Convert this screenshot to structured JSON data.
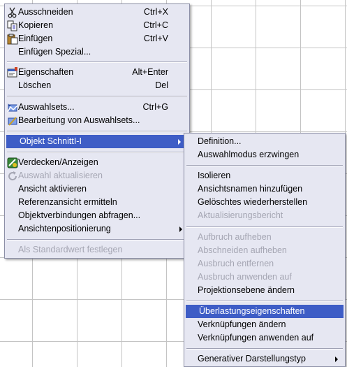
{
  "context_menu": {
    "items": [
      {
        "label": "Ausschneiden",
        "shortcut": "Ctrl+X",
        "icon": "scissors-icon"
      },
      {
        "label": "Kopieren",
        "shortcut": "Ctrl+C",
        "icon": "copy-icon"
      },
      {
        "label": "Einfügen",
        "shortcut": "Ctrl+V",
        "icon": "paste-icon"
      },
      {
        "label": "Einfügen Spezial..."
      },
      {
        "label": "Eigenschaften",
        "shortcut": "Alt+Enter",
        "icon": "properties-icon"
      },
      {
        "label": "Löschen",
        "shortcut": "Del"
      },
      {
        "label": "Auswahlsets...",
        "shortcut": "Ctrl+G",
        "icon": "selection-sets-icon"
      },
      {
        "label": "Bearbeitung von Auswahlsets...",
        "icon": "edit-selection-sets-icon"
      },
      {
        "label": "Objekt SchnittI-I",
        "highlighted": true
      },
      {
        "label": "Verdecken/Anzeigen",
        "icon": "hide-show-icon"
      },
      {
        "label": "Auswahl aktualisieren",
        "disabled": true,
        "icon": "refresh-icon"
      },
      {
        "label": "Ansicht aktivieren"
      },
      {
        "label": "Referenzansicht ermitteln"
      },
      {
        "label": "Objektverbindungen abfragen..."
      },
      {
        "label": "Ansichtenpositionierung"
      },
      {
        "label": "Als Standardwert festlegen",
        "disabled": true
      }
    ]
  },
  "submenu": {
    "items": [
      {
        "label": "Definition..."
      },
      {
        "label": "Auswahlmodus erzwingen"
      },
      {
        "label": "Isolieren"
      },
      {
        "label": "Ansichtsnamen hinzufügen"
      },
      {
        "label": "Gelöschtes wiederherstellen"
      },
      {
        "label": "Aktualisierungsbericht",
        "disabled": true
      },
      {
        "label": "Aufbruch aufheben",
        "disabled": true
      },
      {
        "label": "Abschneiden aufheben",
        "disabled": true
      },
      {
        "label": "Ausbruch entfernen",
        "disabled": true
      },
      {
        "label": "Ausbruch anwenden auf",
        "disabled": true
      },
      {
        "label": "Projektionsebene ändern"
      },
      {
        "label": "Überlastungseigenschaften",
        "highlighted": true
      },
      {
        "label": "Verknüpfungen ändern"
      },
      {
        "label": "Verknüpfungen anwenden auf"
      },
      {
        "label": "Generativer Darstellungstyp"
      }
    ]
  },
  "colors": {
    "menu_background": "#e6e7f2",
    "highlight": "#3e5dc6",
    "disabled_text": "#a5a6b3",
    "grid_lines": "#c4c4c4"
  }
}
